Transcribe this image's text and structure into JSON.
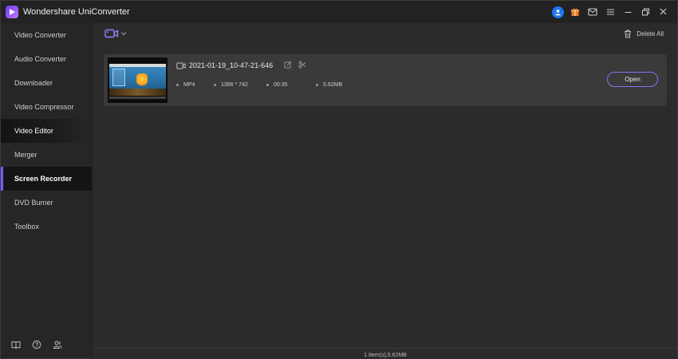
{
  "app": {
    "title": "Wondershare UniConverter"
  },
  "colors": {
    "accent": "#7a5cf0",
    "avatar": "#1f74f0",
    "gift": "#f07a2a"
  },
  "titlebar": {
    "icons": [
      "user-avatar-icon",
      "gift-icon",
      "mail-icon",
      "menu-icon",
      "minimize-icon",
      "restore-icon",
      "close-icon"
    ]
  },
  "sidebar": {
    "items": [
      {
        "label": "Video Converter"
      },
      {
        "label": "Audio Converter"
      },
      {
        "label": "Downloader"
      },
      {
        "label": "Video Compressor"
      },
      {
        "label": "Video Editor"
      },
      {
        "label": "Merger"
      },
      {
        "label": "Screen Recorder"
      },
      {
        "label": "DVD Burner"
      },
      {
        "label": "Toolbox"
      }
    ],
    "active": "Screen Recorder",
    "bottom_icons": [
      "book-icon",
      "help-icon",
      "account-icon"
    ]
  },
  "toolbar": {
    "delete_all_label": "Delete All",
    "record_icon": "video-camera-icon"
  },
  "recording": {
    "file_name": "2021-01-19_10-47-21-646",
    "format": "MP4",
    "resolution": "1366 * 742",
    "duration": "00:35",
    "size": "5.62MB",
    "open_label": "Open"
  },
  "status": {
    "text": "1 Item(s),5.62MB"
  }
}
